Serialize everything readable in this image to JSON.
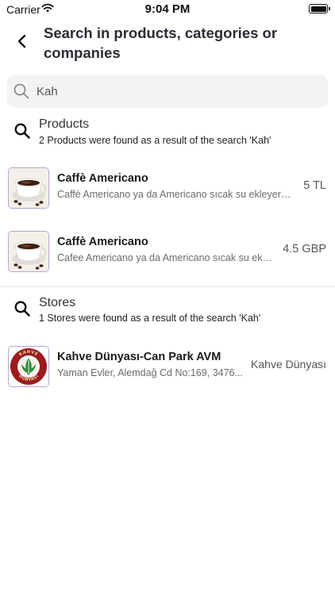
{
  "status_bar": {
    "carrier": "Carrier",
    "time": "9:04 PM"
  },
  "header": {
    "title": "Search in products, categories or companies"
  },
  "search": {
    "value": "Kah"
  },
  "products_section": {
    "title": "Products",
    "subtitle": "2 Products were found as a result of the search 'Kah'",
    "items": [
      {
        "title": "Caffè Americano",
        "description": "Caffè Americano ya da Americano sıcak su ekleyerek...",
        "price": "5 TL"
      },
      {
        "title": "Caffè Americano",
        "description": "Cafee Americano ya da Americano sıcak su ekle...",
        "price": "4.5 GBP"
      }
    ]
  },
  "stores_section": {
    "title": "Stores",
    "subtitle": "1 Stores were found as a result of the search 'Kah'",
    "items": [
      {
        "title": "Kahve Dünyası-Can Park AVM",
        "address": "Yaman Evler, Alemdağ Cd No:169, 3476...",
        "brand": "Kahve Dünyası",
        "logo_text": "KAHVE DÜNYASI"
      }
    ]
  },
  "colors": {
    "accent_border": "#b9a2d6",
    "search_bg": "#f3f3f5",
    "logo_red": "#9b1b1f",
    "logo_green": "#2f8a3c"
  }
}
